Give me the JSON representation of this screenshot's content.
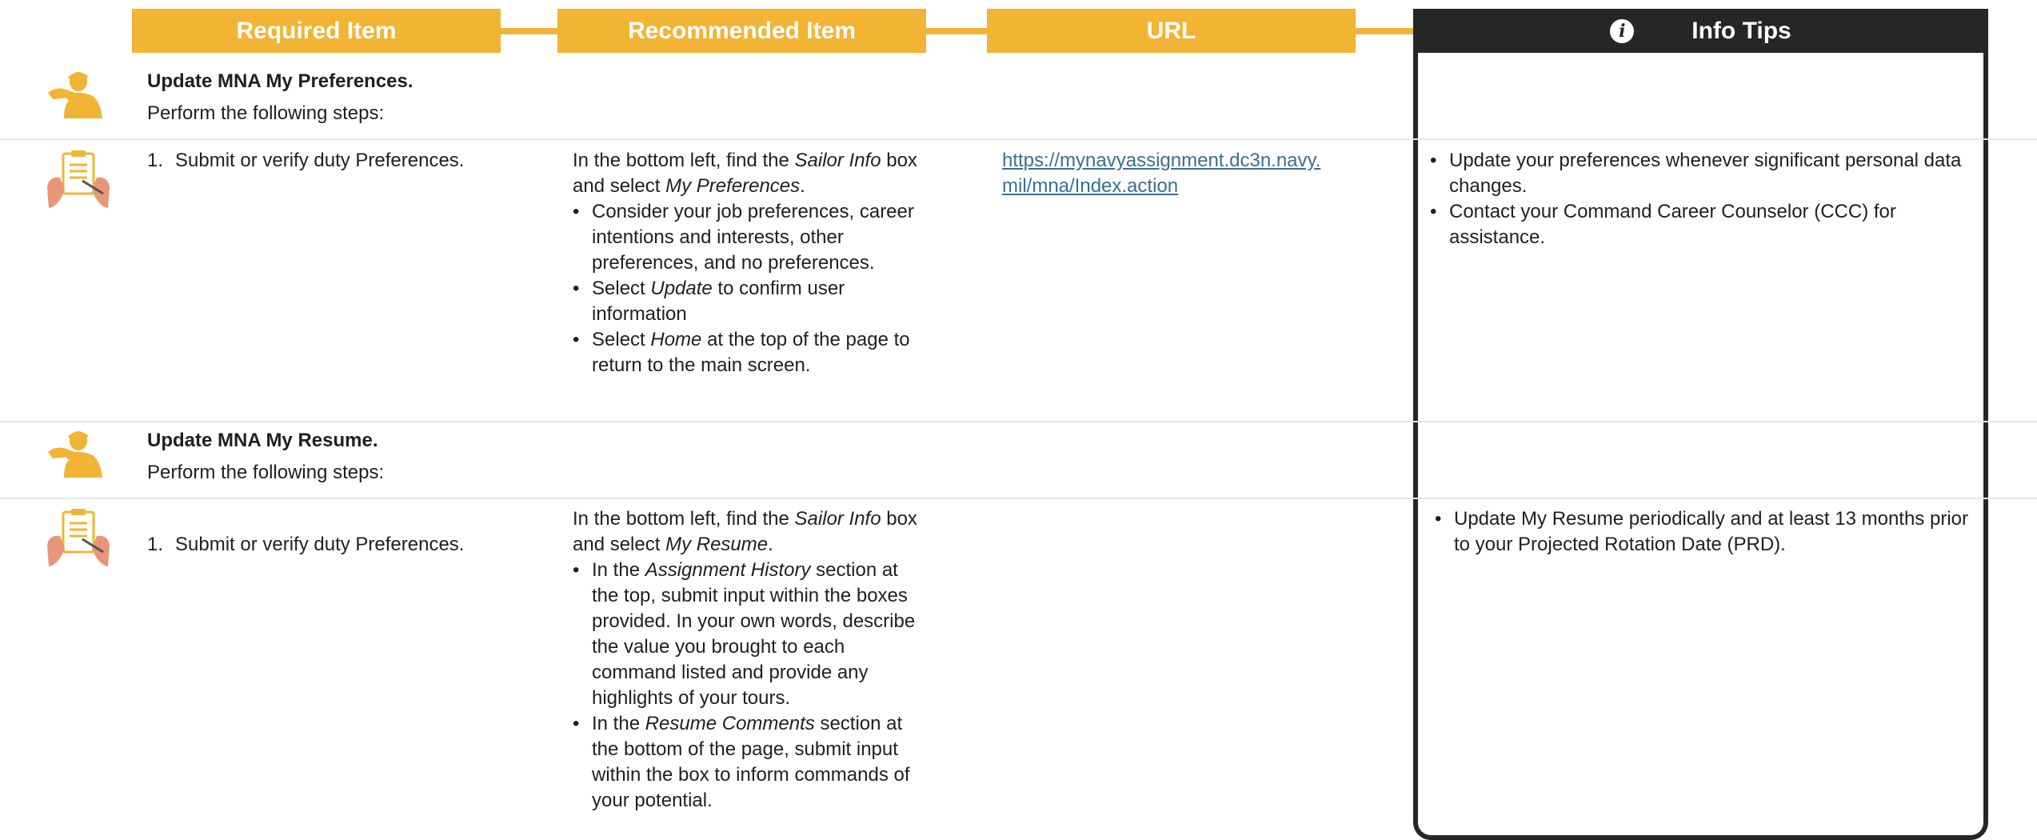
{
  "colors": {
    "accent": "#f1b434",
    "dark": "#262626",
    "link": "#3a6f8f"
  },
  "header": {
    "required": "Required Item",
    "recommended": "Recommended Item",
    "url": "URL",
    "info": "Info Tips",
    "info_icon": "info-icon",
    "info_glyph": "i"
  },
  "sections": [
    {
      "icon": "saluting-sailor-icon",
      "title": "Update MNA My Preferences.",
      "subtitle": "Perform the following steps:",
      "step": {
        "icon": "clipboard-checklist-icon",
        "number": "1.",
        "required": "Submit or verify duty Preferences.",
        "rec_a": "In the bottom left, find the ",
        "rec_b": "Sailor Info",
        "rec_c": " box and select ",
        "rec_d": "My Preferences",
        "rec_e": ".",
        "b1": "Consider your job preferences, career intentions and interests, other preferences, and no preferences.",
        "b2_a": "Select ",
        "b2_b": "Update",
        "b2_c": " to confirm user information",
        "b3_a": "Select ",
        "b3_b": "Home",
        "b3_c": " at the top of the page to return to the main screen.",
        "url_line1": "https://mynavyassignment.dc3n.navy.",
        "url_line2": "mil/mna/Index.action",
        "tip1": "Update your preferences whenever significant personal data changes.",
        "tip2": "Contact your Command Career Counselor (CCC) for assistance."
      }
    },
    {
      "icon": "saluting-sailor-icon",
      "title": "Update MNA My Resume.",
      "subtitle": "Perform the following steps:",
      "step": {
        "icon": "clipboard-checklist-icon",
        "number": "1.",
        "required": "Submit or verify duty Preferences.",
        "rec_a": "In the bottom left, find the ",
        "rec_b": "Sailor Info",
        "rec_c": " box and select ",
        "rec_d": "My Resume",
        "rec_e": ".",
        "b1_a": "In the ",
        "b1_b": "Assignment History",
        "b1_c": " section at the top, submit input within the boxes provided. In your own words, describe the value you brought to each command listed and provide any highlights of your tours.",
        "b2_a": "In the ",
        "b2_b": "Resume Comments",
        "b2_c": " section at the bottom of the page, submit input within the box to inform commands of your potential.",
        "tip1": "Update My Resume periodically and at least 13 months prior to your Projected Rotation Date (PRD)."
      }
    }
  ]
}
